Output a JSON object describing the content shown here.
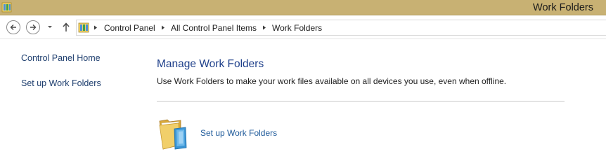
{
  "window": {
    "title": "Work Folders"
  },
  "navigation": {
    "breadcrumb": [
      "Control Panel",
      "All Control Panel Items",
      "Work Folders"
    ]
  },
  "sidebar": {
    "links": [
      {
        "label": "Control Panel Home"
      },
      {
        "label": "Set up Work Folders"
      }
    ]
  },
  "main": {
    "title": "Manage Work Folders",
    "description": "Use Work Folders to make your work files available on all devices you use, even when offline.",
    "task_label": "Set up Work Folders"
  },
  "icons": {
    "title": "control-panel-icon",
    "address": "control-panel-icon",
    "task": "work-folders-icon"
  },
  "colors": {
    "titlebar": "#c8b173",
    "link": "#1e3e6e",
    "heading": "#1e3f8a"
  }
}
